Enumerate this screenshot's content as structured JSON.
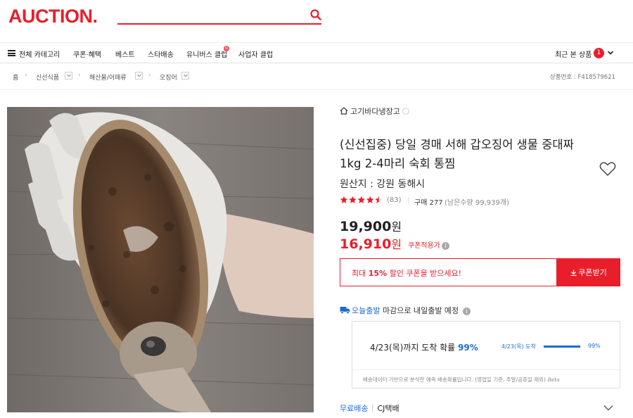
{
  "header": {
    "logo": "AUCTION.",
    "search_placeholder": ""
  },
  "gnb": {
    "all_categories": "전체 카테고리",
    "items": [
      "쿠폰·혜택",
      "베스트",
      "스타배송",
      "유니버스 클럽",
      "사업자 클럽"
    ],
    "new_badge": "N",
    "recent_label": "최근 본 상품",
    "recent_count": "1"
  },
  "breadcrumb": {
    "items": [
      "홈",
      "신선식품",
      "해산물/어패류",
      "오징어"
    ],
    "product_no": "상품번호 : F418579621"
  },
  "product": {
    "store": "고기바다냉장고",
    "title": "(신선집중) 당일 경매 서해 갑오징어 생물 중대짜 1kg 2-4마리 숙회 통찜",
    "origin": "원산지 : 강원 동해시",
    "rating": 4.5,
    "review_count": "(83)",
    "purchase": "구매 277",
    "remaining": "(남은수량 99,939개)",
    "price_original_num": "19,900",
    "price_original_unit": "원",
    "price_sale_num": "16,910",
    "price_sale_unit": "원",
    "coupon_applied": "쿠폰적용가",
    "coupon_pre": "최대 ",
    "coupon_pct": "15%",
    "coupon_post": " 할인 쿠폰을 받으세요!",
    "coupon_button": "쿠폰받기",
    "info_glyph": "i"
  },
  "delivery": {
    "today_label": "오늘출발",
    "today_text": "마감으로 내일출발 예정",
    "arrival_text": "4/23(목)까지 도착 확률 ",
    "arrival_pct": "99%",
    "mini_label": "4/23(목) 도착",
    "mini_pct": "99%",
    "probability": 0.99,
    "note": "배송데이터 기반으로 분석한 예측 배송확률입니다. (영업일 기준, 주말/공휴일 제외) ",
    "note_brand": "Beta",
    "free_shipping": "무료배송",
    "carrier": "CJ택배"
  },
  "colors": {
    "brand": "#e91e2b",
    "link_blue": "#1a6bd8"
  }
}
